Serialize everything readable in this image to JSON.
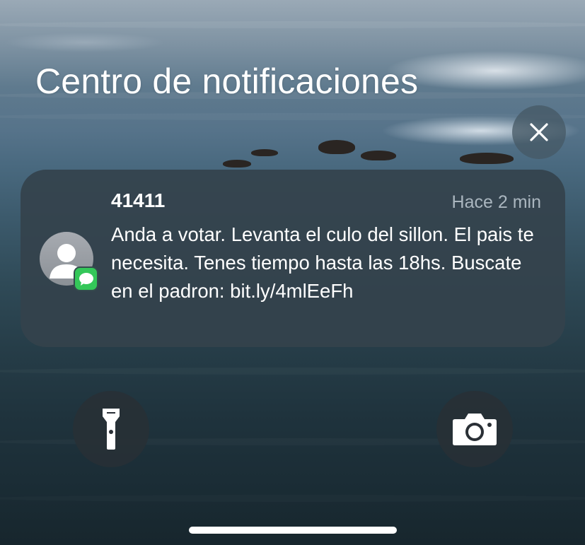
{
  "notification_center": {
    "title": "Centro de notificaciones"
  },
  "notification": {
    "sender": "41411",
    "time": "Hace 2 min",
    "message": "Anda a votar. Levanta el culo del sillon. El pais te necesita. Tenes tiempo hasta las 18hs. Buscate en el padron: bit.ly/4mlEeFh",
    "app_icon": "messages-icon",
    "avatar_icon": "person-icon"
  },
  "controls": {
    "close_icon": "close-icon",
    "flashlight_icon": "flashlight-icon",
    "camera_icon": "camera-icon"
  },
  "colors": {
    "messages_green": "#34c759",
    "card_background": "#34424c",
    "text_primary": "#ffffff"
  }
}
